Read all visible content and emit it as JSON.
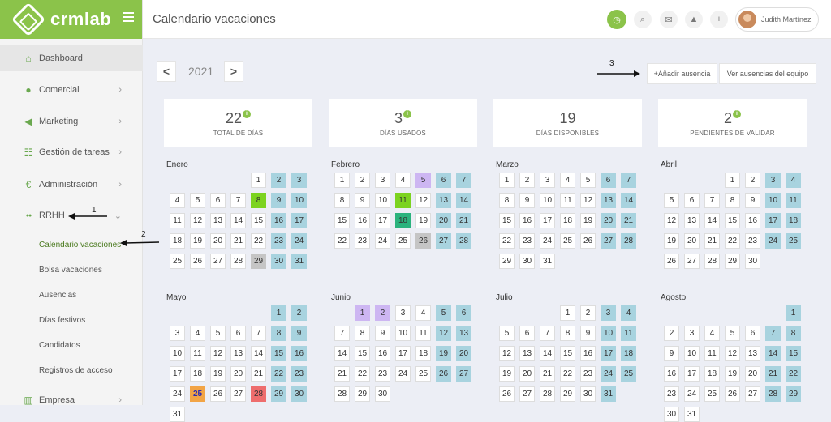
{
  "app": {
    "logo": "crmlab",
    "title": "Calendario vacaciones"
  },
  "colors": {
    "accent": "#8bc34a",
    "weekend": "#a8d3df",
    "used": "#7cd320",
    "pending": "#cdb6f2",
    "holiday_taken": "#2bb37d",
    "rejected": "#ee6d6d",
    "today": "#f2a445",
    "gray": "#c5c5c5"
  },
  "user": {
    "name": "Judith Martínez"
  },
  "nav": {
    "items": [
      {
        "label": "Dashboard",
        "icon": "home-icon",
        "chevron": false
      },
      {
        "label": "Comercial",
        "icon": "person-icon",
        "chevron": true
      },
      {
        "label": "Marketing",
        "icon": "megaphone-icon",
        "chevron": true
      },
      {
        "label": "Gestión de tareas",
        "icon": "tasks-icon",
        "chevron": true
      },
      {
        "label": "Administración",
        "icon": "euro-icon",
        "chevron": true
      },
      {
        "label": "RRHH",
        "icon": "users-icon",
        "chevron": true
      }
    ],
    "sub": [
      "Calendario vacaciones",
      "Bolsa vacaciones",
      "Ausencias",
      "Días festivos",
      "Candidatos",
      "Registros de acceso"
    ],
    "last": {
      "label": "Empresa",
      "icon": "building-icon"
    }
  },
  "toolbar": {
    "year": "2021",
    "prev": "<",
    "next": ">",
    "add": "+Añadir ausencia",
    "team": "Ver ausencias del equipo"
  },
  "stats": [
    {
      "num": "22",
      "label": "TOTAL DE DÍAS",
      "info": true
    },
    {
      "num": "3",
      "label": "DÍAS USADOS",
      "info": true
    },
    {
      "num": "19",
      "label": "DÍAS DISPONIBLES",
      "info": false
    },
    {
      "num": "2",
      "label": "PENDIENTES DE VALIDAR",
      "info": true
    }
  ],
  "annotations": [
    "1",
    "2",
    "3"
  ],
  "months": [
    {
      "name": "Enero",
      "offset": 4,
      "days": 31,
      "marks": {
        "8": "lime",
        "29": "gray"
      }
    },
    {
      "name": "Febrero",
      "offset": 0,
      "days": 28,
      "marks": {
        "5": "purple",
        "11": "lime",
        "18": "dgreen",
        "26": "gray"
      }
    },
    {
      "name": "Marzo",
      "offset": 0,
      "days": 31,
      "marks": {}
    },
    {
      "name": "Abril",
      "offset": 3,
      "days": 30,
      "marks": {}
    },
    {
      "name": "Mayo",
      "offset": 5,
      "days": 31,
      "marks": {
        "25": "orange",
        "28": "red"
      }
    },
    {
      "name": "Junio",
      "offset": 1,
      "days": 30,
      "marks": {
        "1": "purple",
        "2": "purple"
      }
    },
    {
      "name": "Julio",
      "offset": 3,
      "days": 31,
      "marks": {}
    },
    {
      "name": "Agosto",
      "offset": 6,
      "days": 31,
      "marks": {}
    }
  ]
}
